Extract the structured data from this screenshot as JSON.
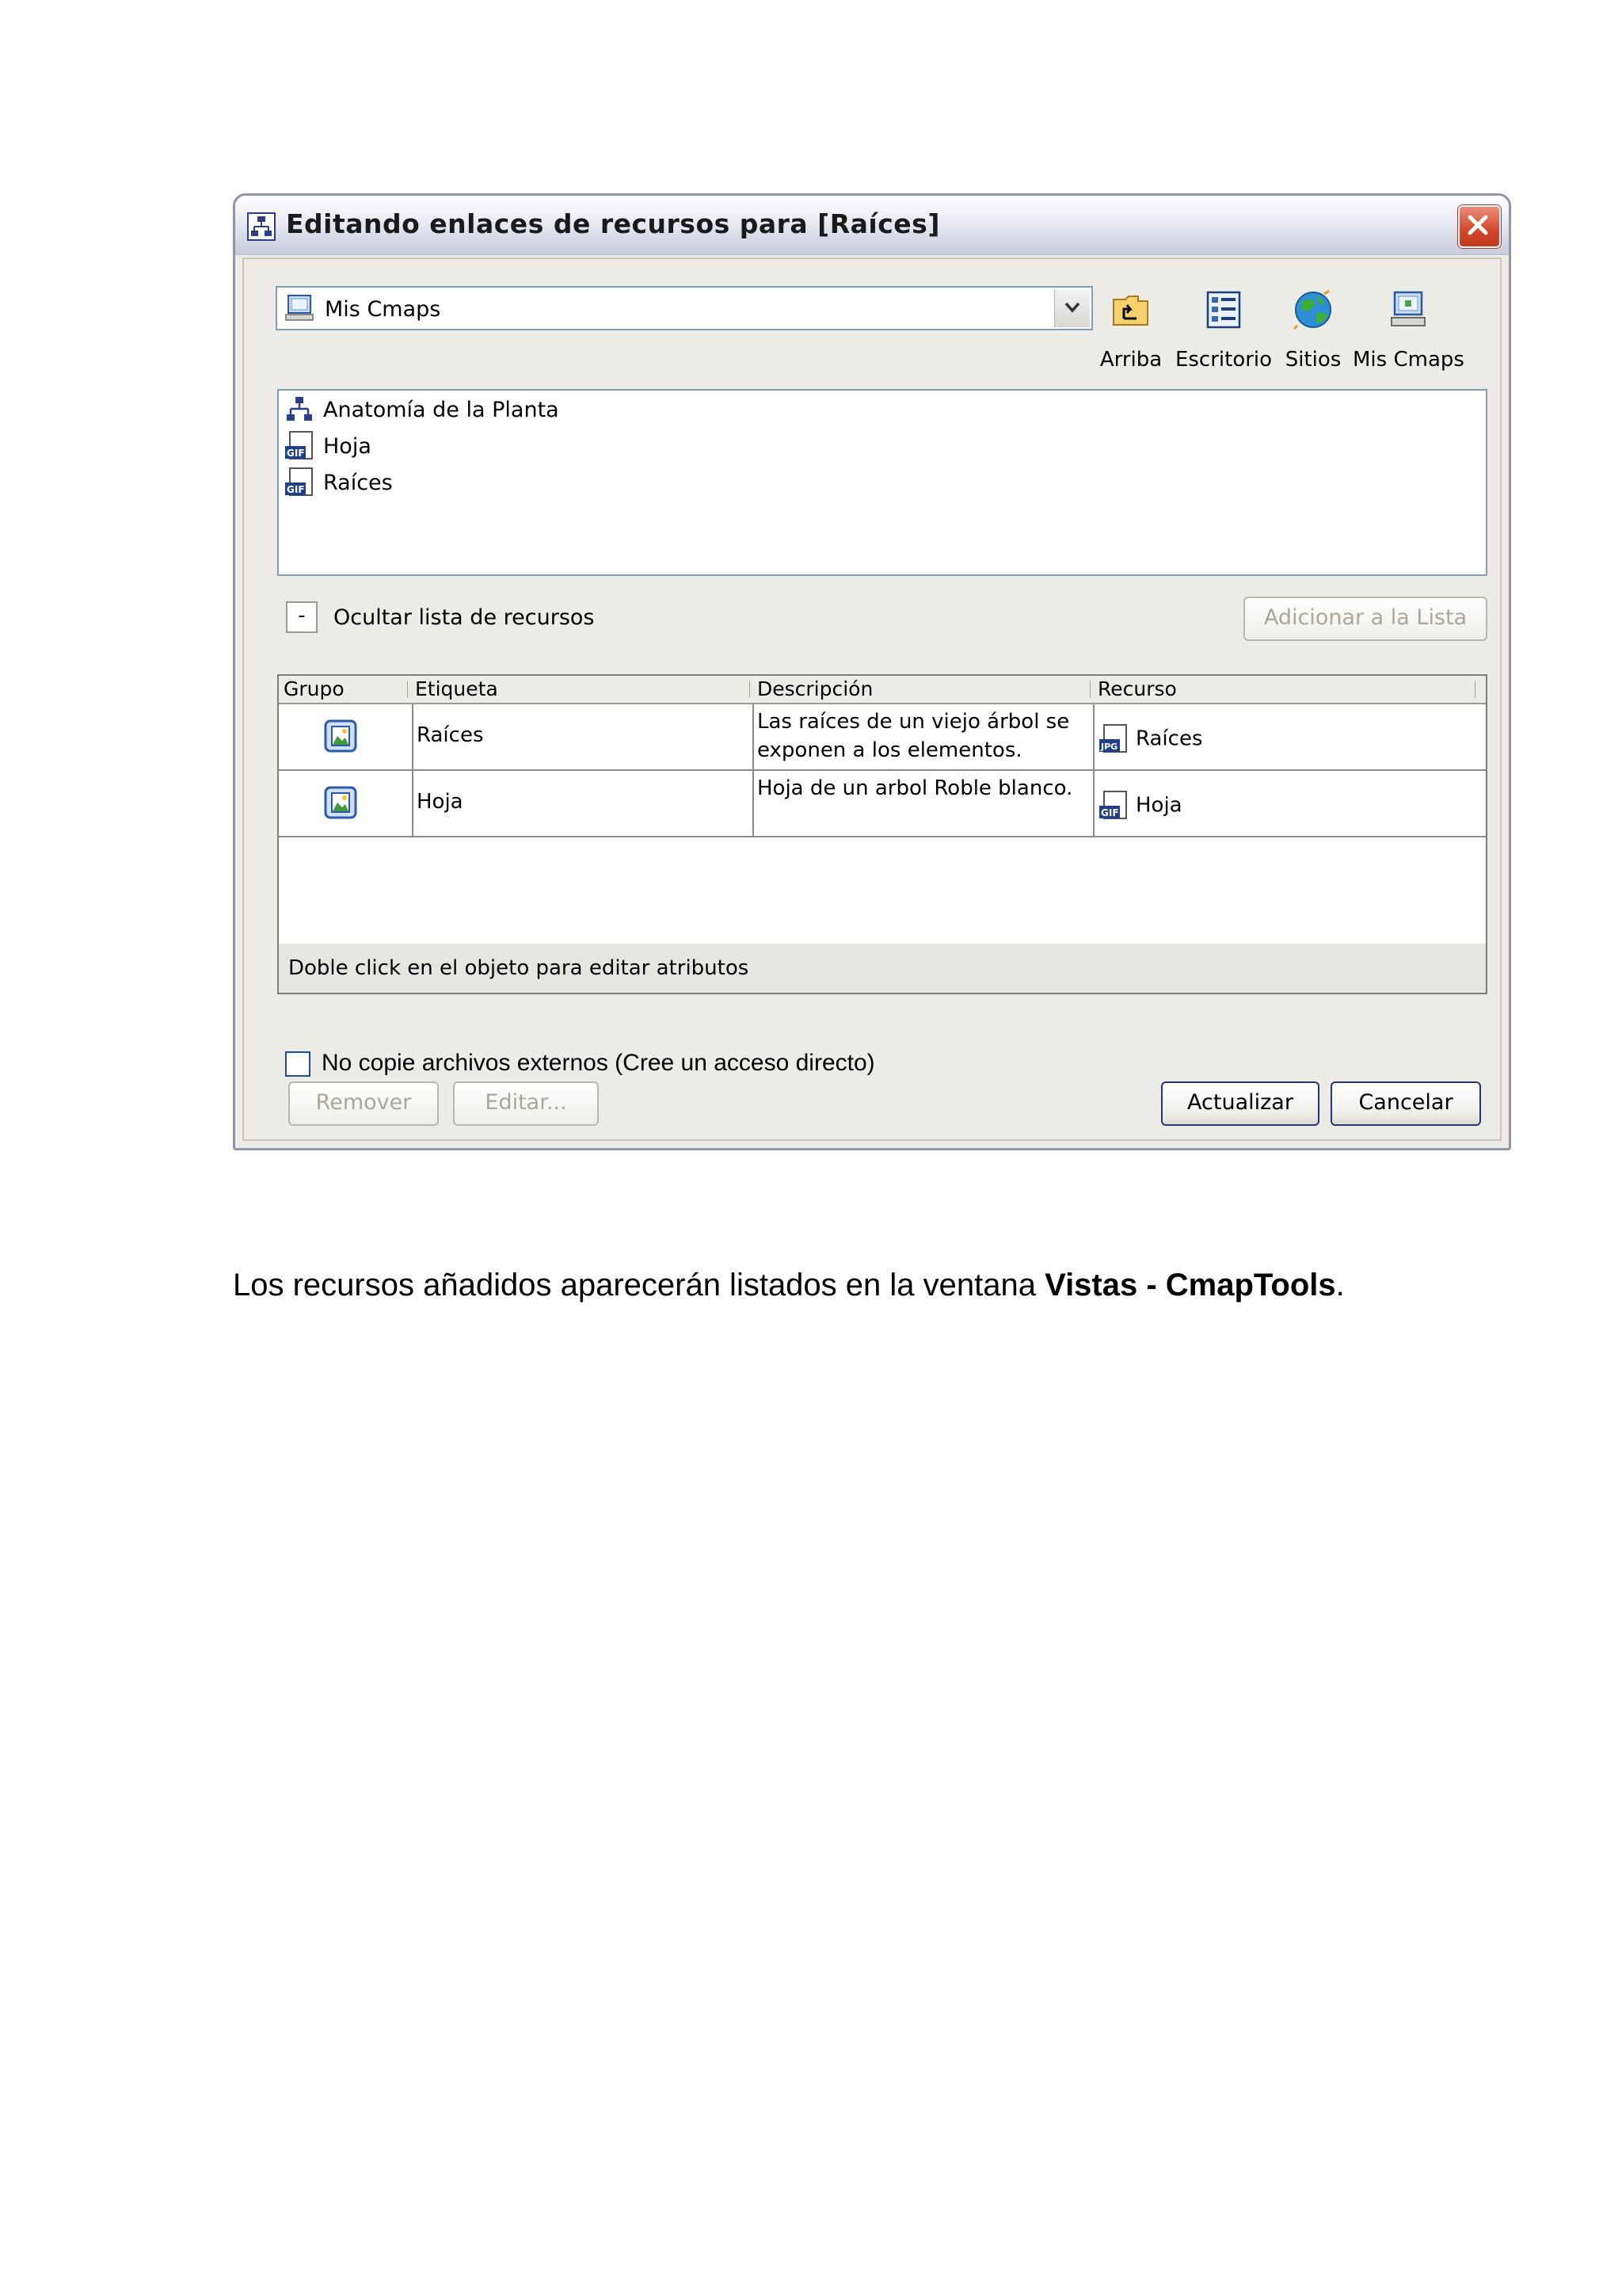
{
  "dialog": {
    "title": "Editando enlaces de recursos para [Raíces]",
    "location_value": "Mis Cmaps",
    "toolbar": [
      {
        "label": "Arriba",
        "icon": "folder-up-icon"
      },
      {
        "label": "Escritorio",
        "icon": "desktop-icon"
      },
      {
        "label": "Sitios",
        "icon": "globe-icon"
      },
      {
        "label": "Mis Cmaps",
        "icon": "computer-icon"
      }
    ],
    "files": [
      {
        "name": "Anatomía de la Planta",
        "icon": "cmap-icon"
      },
      {
        "name": "Hoja",
        "icon": "gif-file-icon"
      },
      {
        "name": "Raíces",
        "icon": "gif-file-icon"
      }
    ],
    "toggle_label": "Ocultar lista de recursos",
    "toggle_symbol": "-",
    "add_button": "Adicionar a la Lista",
    "table": {
      "columns": [
        "Grupo",
        "Etiqueta",
        "Descripción",
        "Recurso"
      ],
      "rows": [
        {
          "etiqueta": "Raíces",
          "descripcion": "Las raíces de un viejo árbol se exponen a los elementos.",
          "recurso": "Raíces",
          "recurso_icon": "jpg-file-icon"
        },
        {
          "etiqueta": "Hoja",
          "descripcion": "Hoja de un arbol Roble blanco.",
          "recurso": "Hoja",
          "recurso_icon": "gif-file-icon"
        }
      ],
      "footer": "Doble click en el objeto para editar atributos"
    },
    "checkbox_label": "No copie archivos externos (Cree un acceso directo)",
    "checkbox_checked": false,
    "buttons": {
      "remove": "Remover",
      "edit": "Editar...",
      "update": "Actualizar",
      "cancel": "Cancelar"
    }
  },
  "caption": {
    "prefix": "Los recursos añadidos aparecerán listados en la ventana ",
    "bold": "Vistas - CmapTools",
    "suffix": "."
  },
  "colors": {
    "dialog_bg": "#ecebe6",
    "list_border": "#7f9db9",
    "close_red": "#d3472a",
    "title_bar": "#d5d9e6"
  }
}
